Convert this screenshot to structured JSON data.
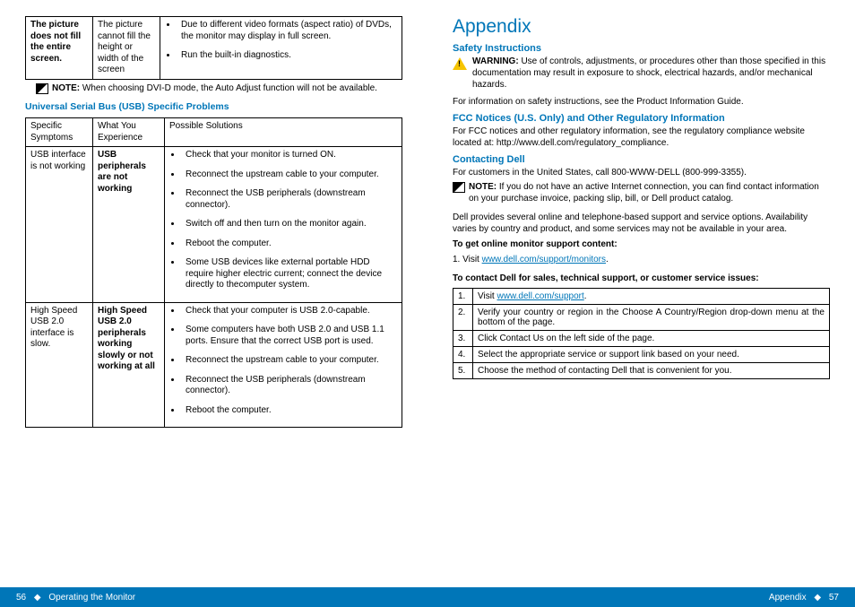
{
  "left": {
    "table1": {
      "c1": "The picture does not fill the entire screen.",
      "c2": "The picture cannot fill the height or width of the screen",
      "b1": "Due to different video formats (aspect ratio) of DVDs, the monitor may display in full screen.",
      "b2": "Run the built-in diagnostics."
    },
    "note1_label": "NOTE:",
    "note1_text": " When choosing DVI-D mode, the Auto Adjust function will not be available.",
    "usb_heading": "Universal Serial Bus (USB) Specific Problems",
    "hdr1": "Specific Symptoms",
    "hdr2": "What You Experience",
    "hdr3": "Possible Solutions",
    "r1c1": "USB interface is not working",
    "r1c2": "USB peripherals are not working",
    "r1b": [
      "Check that your monitor is turned ON.",
      "Reconnect the upstream cable to your computer.",
      "Reconnect the USB peripherals (downstream connector).",
      "Switch off and then turn on the monitor again.",
      "Reboot the computer.",
      "Some USB devices like external portable HDD require higher electric current; connect the device directly to thecomputer system."
    ],
    "r2c1": "High Speed USB 2.0 interface is slow.",
    "r2c2": "High Speed USB 2.0 peripherals working slowly or not working at all",
    "r2b": [
      "Check that your computer is USB 2.0-capable.",
      "Some computers have both USB 2.0 and USB 1.1 ports. Ensure that the correct USB port is used.",
      "Reconnect the upstream cable to your computer.",
      "Reconnect the USB peripherals (downstream connector).",
      "Reboot the computer."
    ]
  },
  "right": {
    "appendix": "Appendix",
    "safety_head": "Safety Instructions",
    "warn_label": "WARNING:",
    "warn_text": " Use of controls, adjustments, or procedures other than those specified in this documentation may result in exposure to shock, electrical hazards, and/or mechanical hazards.",
    "para1": "For information on safety instructions, see the Product Information Guide.",
    "fcc_head": "FCC Notices (U.S. Only) and Other Regulatory Information",
    "fcc_text": "For FCC notices and other regulatory information, see the regulatory compliance website located at: http://www.dell.com/regulatory_compliance.",
    "contact_head": "Contacting Dell",
    "contact_para": "For customers in the United States, call 800-WWW-DELL (800-999-3355).",
    "note2_label": "NOTE:",
    "note2_text": " If you do not have an active Internet connection, you can find contact information on your purchase invoice, packing slip, bill, or Dell product catalog.",
    "para_support": "Dell provides several online and telephone-based support and service options. Availability varies by country and product, and some services may not be available in your area.",
    "online_head": "To get online monitor support content:",
    "online_step": "1. Visit ",
    "online_link": "www.dell.com/support/monitors",
    "contact_issues_head": "To contact Dell for sales, technical support, or customer service issues:",
    "steps": [
      {
        "n": "1.",
        "t_pre": "Visit ",
        "link": "www.dell.com/support",
        "t_post": "."
      },
      {
        "n": "2.",
        "t": "Verify your country or region in the Choose A Country/Region drop-down menu at the bottom of the page."
      },
      {
        "n": "3.",
        "t": "Click Contact Us on the left side of the page."
      },
      {
        "n": "4.",
        "t": "Select the appropriate service or support link based on your need."
      },
      {
        "n": "5.",
        "t": "Choose the method of contacting Dell that is convenient for you."
      }
    ]
  },
  "footer": {
    "left_num": "56",
    "left_text": "Operating the Monitor",
    "right_text": "Appendix",
    "right_num": "57",
    "diamond": "◆"
  }
}
